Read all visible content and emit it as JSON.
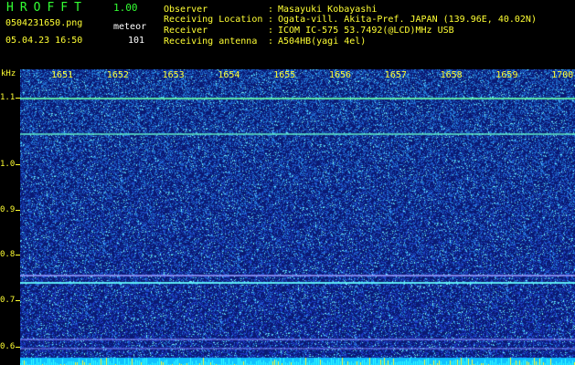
{
  "header": {
    "app_title": "HROFFT",
    "app_version": "1.00",
    "filename": "0504231650.png",
    "mode": "meteor",
    "datetime": "05.04.23 16:50",
    "count": "101",
    "fields": [
      {
        "label": "Observer",
        "value": "Masayuki Kobayashi"
      },
      {
        "label": "Receiving Location",
        "value": "Ogata-vill. Akita-Pref. JAPAN (139.96E, 40.02N)"
      },
      {
        "label": "Receiver",
        "value": "ICOM IC-575 53.7492(@LCD)MHz USB"
      },
      {
        "label": "Receiving antenna",
        "value": "A504HB(yagi 4el)"
      }
    ],
    "separator": ":"
  },
  "spectrogram": {
    "y_unit": "kHz",
    "y_ticks": [
      "1.1",
      "1.0",
      "0.9",
      "0.8",
      "0.7",
      "0.6"
    ],
    "x_ticks": [
      "1651",
      "1652",
      "1653",
      "1654",
      "1655",
      "1656",
      "1657",
      "1658",
      "1659",
      "1700"
    ],
    "colors": {
      "text": "#ffff33",
      "background": "#0a1a6e",
      "signal": "#33ffff",
      "noise": "#2050d0"
    }
  }
}
